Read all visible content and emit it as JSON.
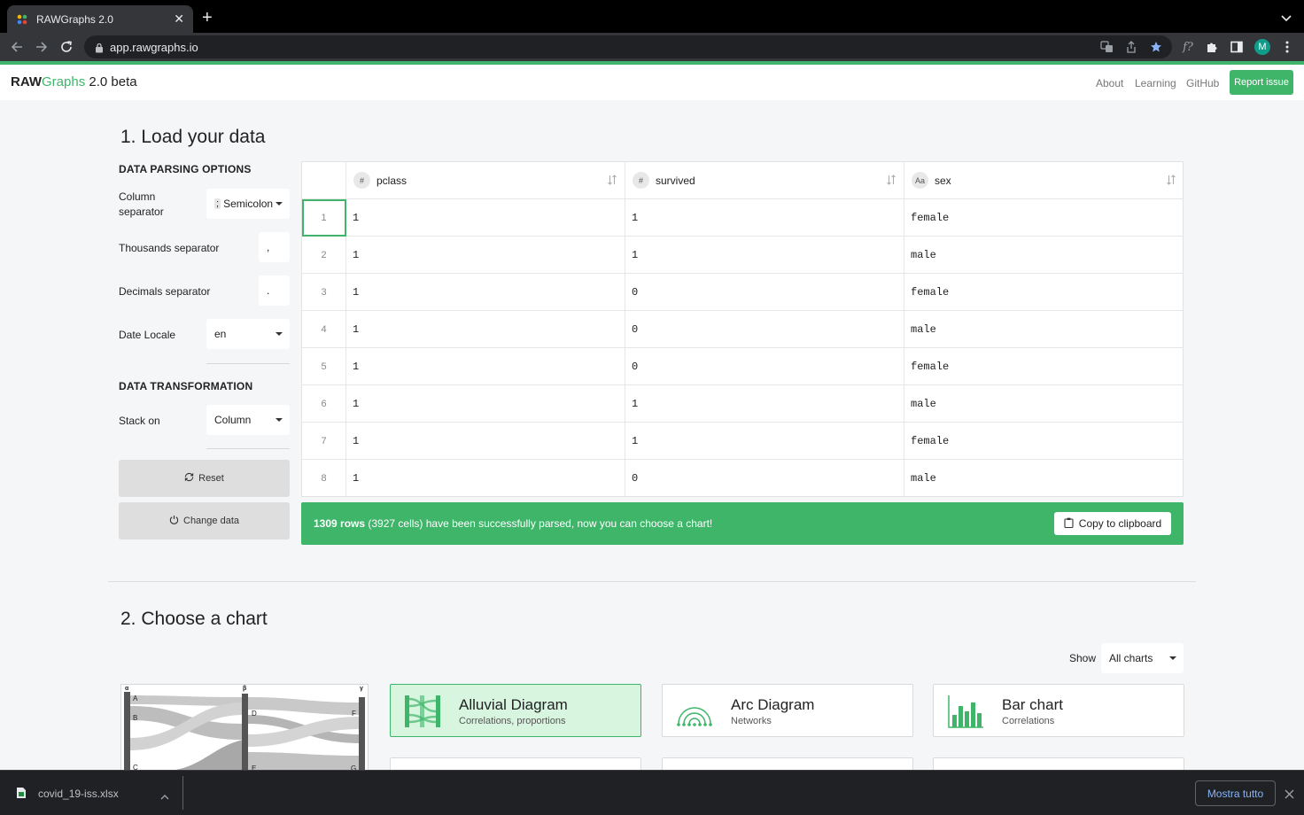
{
  "browser": {
    "tab_title": "RAWGraphs 2.0",
    "url": "app.rawgraphs.io",
    "profile_initial": "M"
  },
  "header": {
    "brand_raw": "RAW",
    "brand_graphs": "Graphs",
    "brand_version": " 2.0 beta",
    "nav": [
      "About",
      "Learning",
      "GitHub"
    ],
    "report_button": "Report issue"
  },
  "load": {
    "title": "1. Load your data",
    "parsing_heading": "DATA PARSING OPTIONS",
    "column_separator_label": "Column separator",
    "column_separator_glyph": ";",
    "column_separator_value": "Semicolon",
    "thousands_label": "Thousands separator",
    "thousands_value": ",",
    "decimals_label": "Decimals separator",
    "decimals_value": ".",
    "date_locale_label": "Date Locale",
    "date_locale_value": "en",
    "transform_heading": "DATA TRANSFORMATION",
    "stack_label": "Stack on",
    "stack_value": "Column",
    "reset_button": "Reset",
    "change_button": "Change data"
  },
  "table": {
    "columns": [
      {
        "type": "#",
        "name": "pclass"
      },
      {
        "type": "#",
        "name": "survived"
      },
      {
        "type": "Aa",
        "name": "sex"
      }
    ],
    "rows": [
      {
        "n": "1",
        "cells": [
          "1",
          "1",
          "female"
        ]
      },
      {
        "n": "2",
        "cells": [
          "1",
          "1",
          "male"
        ]
      },
      {
        "n": "3",
        "cells": [
          "1",
          "0",
          "female"
        ]
      },
      {
        "n": "4",
        "cells": [
          "1",
          "0",
          "male"
        ]
      },
      {
        "n": "5",
        "cells": [
          "1",
          "0",
          "female"
        ]
      },
      {
        "n": "6",
        "cells": [
          "1",
          "1",
          "male"
        ]
      },
      {
        "n": "7",
        "cells": [
          "1",
          "1",
          "female"
        ]
      },
      {
        "n": "8",
        "cells": [
          "1",
          "0",
          "male"
        ]
      }
    ]
  },
  "status": {
    "rows_bold": "1309 rows",
    "message": " (3927 cells) have been successfully parsed, now you can choose a chart!",
    "copy_button": "Copy to clipboard"
  },
  "choose": {
    "title": "2. Choose a chart",
    "show_label": "Show",
    "show_value": "All charts",
    "preview_labels": {
      "col_a": "α",
      "col_b": "β",
      "col_c": "γ",
      "a": "A",
      "b": "B",
      "c": "C",
      "d": "D",
      "e": "E",
      "f": "F",
      "g": "G"
    },
    "charts": [
      {
        "title": "Alluvial Diagram",
        "sub": "Correlations, proportions",
        "icon": "alluvial-icon"
      },
      {
        "title": "Arc Diagram",
        "sub": "Networks",
        "icon": "arc-icon"
      },
      {
        "title": "Bar chart",
        "sub": "Correlations",
        "icon": "bar-icon"
      }
    ]
  },
  "download": {
    "file_name": "covid_19-iss.xlsx",
    "show_all": "Mostra tutto"
  },
  "colors": {
    "accent": "#3fb56a",
    "active_card": "#d7f5df"
  }
}
